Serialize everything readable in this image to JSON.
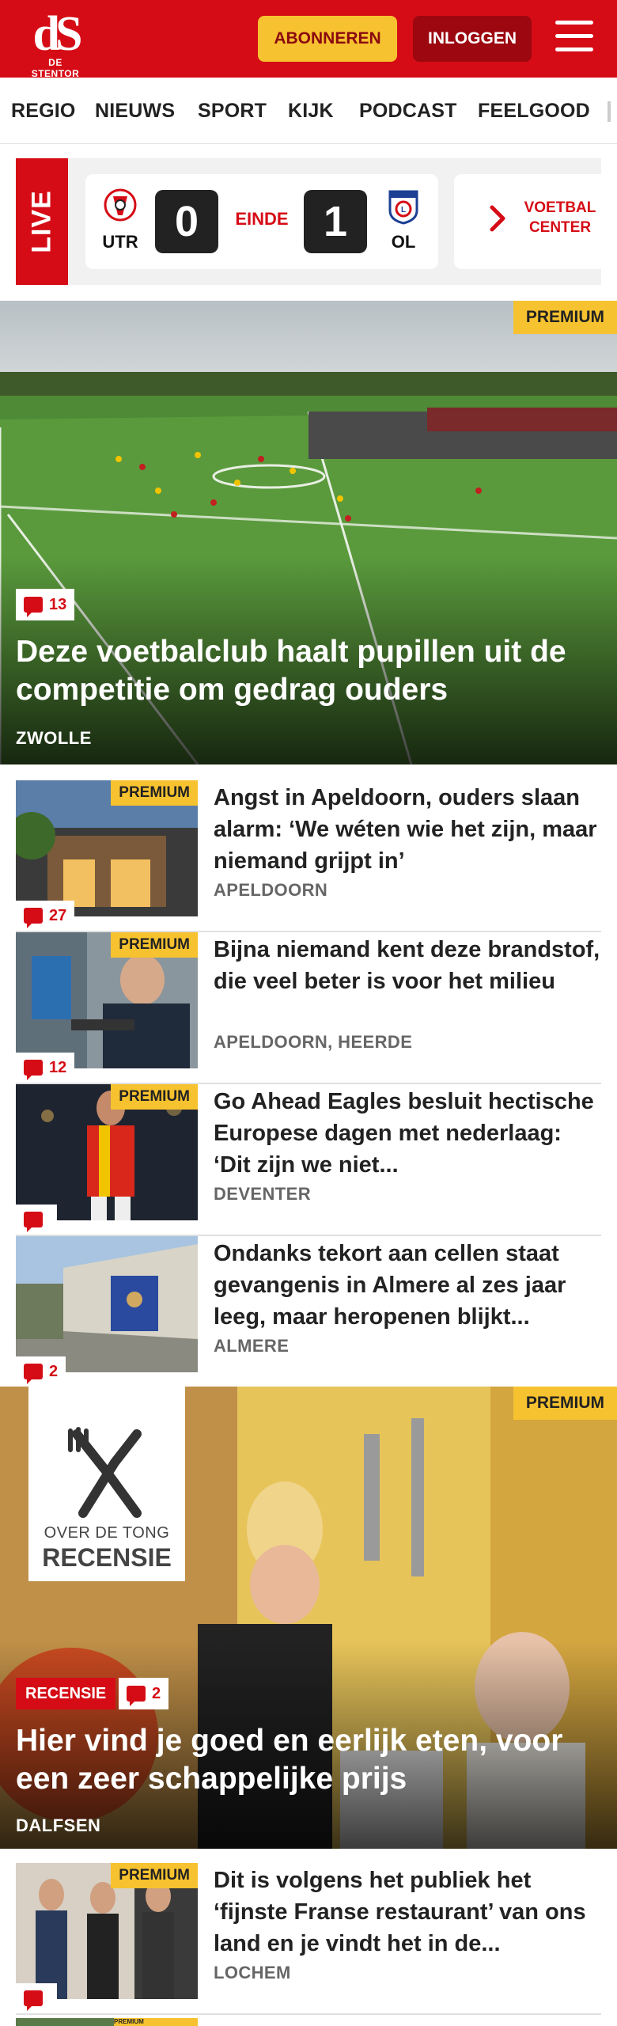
{
  "header": {
    "logo_mark": "dS",
    "logo_text": "DE STENTOR",
    "subscribe_label": "ABONNEREN",
    "login_label": "INLOGGEN",
    "colors": {
      "brand_red": "#d50c16",
      "accent_yellow": "#f7c22f",
      "login_dark_red": "#9c0710"
    }
  },
  "nav": {
    "items": [
      "REGIO",
      "NIEUWS",
      "SPORT",
      "KIJK",
      "PODCAST",
      "FEELGOOD"
    ]
  },
  "live": {
    "tag": "LIVE",
    "match": {
      "home": "UTR",
      "away": "OL",
      "home_score": "0",
      "away_score": "1",
      "status": "EINDE"
    },
    "voetbal_center_label_1": "VOETBAL",
    "voetbal_center_label_2": "CENTER"
  },
  "hero": {
    "badge": "PREMIUM",
    "comments": "13",
    "title": "Deze voetbalclub haalt pupillen uit de competitie om gedrag ouders",
    "location": "ZWOLLE"
  },
  "articles": [
    {
      "premium": "PREMIUM",
      "comments": "27",
      "title": "Angst in Apeldoorn, ouders slaan alarm: ‘We wéten wie het zijn, maar niemand grijpt in’",
      "location": "APELDOORN"
    },
    {
      "premium": "PREMIUM",
      "comments": "12",
      "title": "Bijna niemand kent deze brandstof, die veel beter is voor het milieu",
      "location": "APELDOORN, HEERDE"
    },
    {
      "premium": "PREMIUM",
      "comments": "",
      "title": "Go Ahead Eagles besluit hectische Europese dagen met nederlaag: ‘Dit zijn we niet...",
      "location": "DEVENTER"
    },
    {
      "premium": "",
      "comments": "2",
      "title": "Ondanks tekort aan cellen staat gevangenis in Almere al zes jaar leeg, maar heropenen blijkt...",
      "location": "ALMERE"
    }
  ],
  "review": {
    "badge": "PREMIUM",
    "series_top": "OVER DE TONG",
    "series_main": "RECENSIE",
    "tag": "RECENSIE",
    "comments": "2",
    "title": "Hier vind je goed en eerlijk eten, voor een zeer schappelijke prijs",
    "location": "DALFSEN"
  },
  "article_after_review": {
    "premium": "PREMIUM",
    "comments": "",
    "title": "Dit is volgens het publiek het ‘fijnste Franse restaurant’ van ons land en je vindt het in de...",
    "location": "LOCHEM"
  },
  "next_teaser": {
    "premium": "PREMIUM"
  }
}
